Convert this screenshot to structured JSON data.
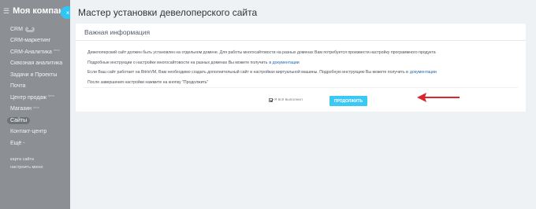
{
  "sidebar": {
    "company": "Моя компания",
    "items": [
      {
        "label": "CRM",
        "count": "36"
      },
      {
        "label": "CRM-маркетинг"
      },
      {
        "label": "CRM-Аналитика",
        "sup": "beta"
      },
      {
        "label": "Сквозная аналитика"
      },
      {
        "label": "Задачи и Проекты"
      },
      {
        "label": "Почта"
      },
      {
        "label": "Центр продаж",
        "sup": "beta"
      },
      {
        "label": "Магазин",
        "sup": "beta"
      },
      {
        "label": "Сайты",
        "active": true
      },
      {
        "label": "Контакт-центр"
      },
      {
        "label": "Ещё -"
      }
    ],
    "small_items": [
      "карта сайта",
      "настроить меню"
    ]
  },
  "panel": {
    "title": "Мастер установки девелоперского сайта",
    "close_symbol": "×",
    "card_title": "Важная информация",
    "lines": {
      "l1": "Девелоперский сайт должен быть установлен на отдельном домене. Для работы многосайтовости на разных доменах Вам потребуется произвести настройку программного продукта",
      "l2_text": "Подробные инструкции о настройке многосайтовости на разных доменах Вы можете получить",
      "l2_link": "в документации",
      "l3_text": "Если Ваш сайт работает на BitrixVM, Вам необходимо создать дополнительный сайт в настройках виртуальной машины. Подробную инструкцию Вы можете получить в",
      "l3_link": "документации",
      "l4": "После завершения настройки нажмите на кнопку \"Продолжить\""
    },
    "agree_label": "Я всё выполнил",
    "continue_label": "ПРОДОЛЖИТЬ"
  },
  "colors": {
    "accent": "#3bc8f5",
    "link": "#2067b0",
    "arrow": "#d9262b"
  },
  "icons": [
    "burger-icon",
    "close-icon",
    "checkbox-checked-icon",
    "red-arrow-annotation"
  ]
}
